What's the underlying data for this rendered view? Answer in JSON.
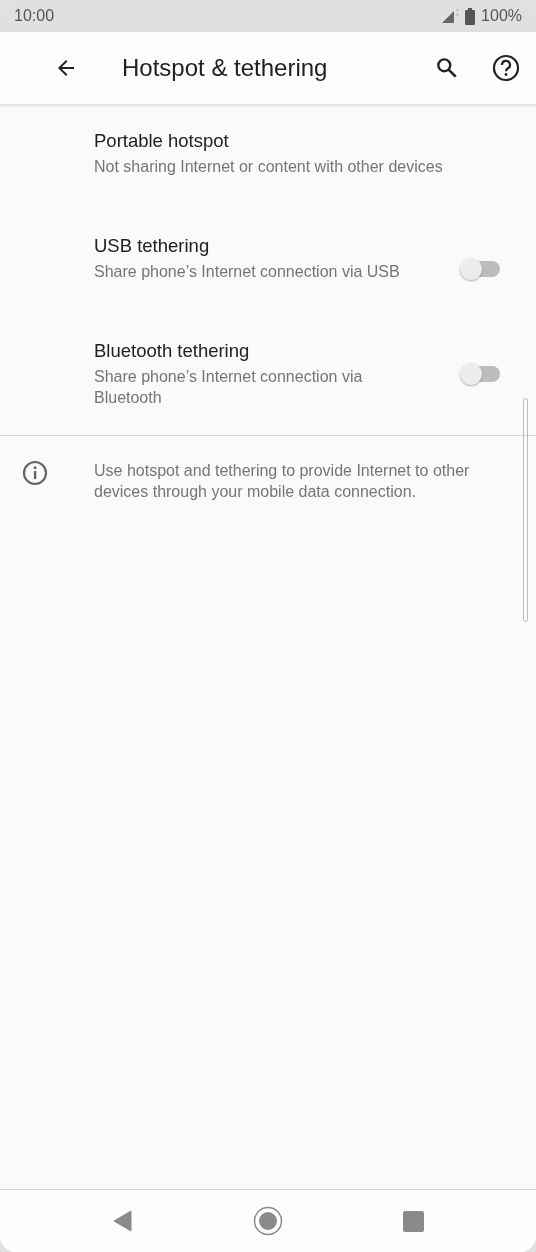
{
  "status_bar": {
    "time": "10:00",
    "battery": "100%"
  },
  "app_bar": {
    "title": "Hotspot & tethering"
  },
  "settings": [
    {
      "kind": "plain",
      "title": "Portable hotspot",
      "summary": "Not sharing Internet or content with other devices"
    },
    {
      "kind": "switch",
      "title": "USB tethering",
      "summary": "Share phone’s Internet connection via USB",
      "on": false
    },
    {
      "kind": "switch",
      "title": "Bluetooth tethering",
      "summary": "Share phone’s Internet connection via Bluetooth",
      "on": false
    }
  ],
  "footer": {
    "text": "Use hotspot and tethering to provide Internet to other devices through your mobile data connection."
  }
}
